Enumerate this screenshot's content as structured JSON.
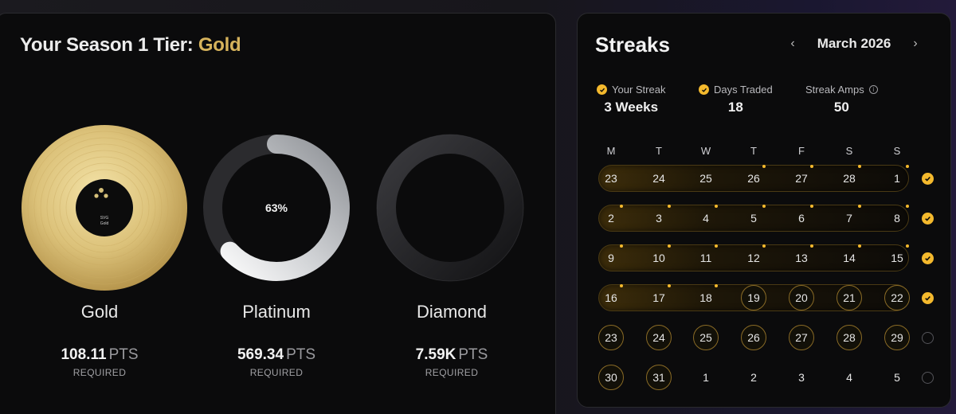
{
  "tier": {
    "title_prefix": "Your Season 1 Tier: ",
    "title_tier": "Gold",
    "tiers": [
      {
        "name": "Gold",
        "pts_value": "108.11",
        "pts_unit": "PTS",
        "required_label": "REQUIRED",
        "icon": "gold-record-icon"
      },
      {
        "name": "Platinum",
        "pts_value": "569.34",
        "pts_unit": "PTS",
        "required_label": "REQUIRED",
        "icon": "platinum-progress-ring",
        "progress_label": "63%",
        "progress": 0.63
      },
      {
        "name": "Diamond",
        "pts_value": "7.59K",
        "pts_unit": "PTS",
        "required_label": "REQUIRED",
        "icon": "diamond-ring-icon"
      }
    ],
    "record_label": "SVG\nGold"
  },
  "streaks": {
    "title": "Streaks",
    "month": "March 2026",
    "prev_icon": "chevron-left-icon",
    "next_icon": "chevron-right-icon",
    "stats": [
      {
        "label": "Your Streak",
        "value": "3 Weeks",
        "icon": "check-icon"
      },
      {
        "label": "Days Traded",
        "value": "18",
        "icon": "check-icon"
      },
      {
        "label": "Streak Amps",
        "value": "50",
        "icon": "info-icon"
      }
    ],
    "weekdays": [
      "M",
      "T",
      "W",
      "T",
      "F",
      "S",
      "S"
    ],
    "weeks": [
      {
        "days": [
          "23",
          "24",
          "25",
          "26",
          "27",
          "28",
          "1"
        ],
        "traded": [
          false,
          false,
          false,
          true,
          true,
          true,
          true
        ],
        "ringed": [
          false,
          false,
          false,
          false,
          false,
          false,
          false
        ],
        "complete": true,
        "bar": true
      },
      {
        "days": [
          "2",
          "3",
          "4",
          "5",
          "6",
          "7",
          "8"
        ],
        "traded": [
          true,
          true,
          true,
          true,
          true,
          true,
          true
        ],
        "ringed": [
          false,
          false,
          false,
          false,
          false,
          false,
          false
        ],
        "complete": true,
        "bar": true
      },
      {
        "days": [
          "9",
          "10",
          "11",
          "12",
          "13",
          "14",
          "15"
        ],
        "traded": [
          true,
          true,
          true,
          true,
          true,
          true,
          true
        ],
        "ringed": [
          false,
          false,
          false,
          false,
          false,
          false,
          false
        ],
        "complete": true,
        "bar": true
      },
      {
        "days": [
          "16",
          "17",
          "18",
          "19",
          "20",
          "21",
          "22"
        ],
        "traded": [
          true,
          true,
          true,
          false,
          false,
          false,
          false
        ],
        "ringed": [
          false,
          false,
          false,
          true,
          true,
          true,
          true
        ],
        "complete": true,
        "bar": true
      },
      {
        "days": [
          "23",
          "24",
          "25",
          "26",
          "27",
          "28",
          "29"
        ],
        "traded": [
          false,
          false,
          false,
          false,
          false,
          false,
          false
        ],
        "ringed": [
          true,
          true,
          true,
          true,
          true,
          true,
          true
        ],
        "complete": false,
        "bar": false
      },
      {
        "days": [
          "30",
          "31",
          "1",
          "2",
          "3",
          "4",
          "5"
        ],
        "traded": [
          false,
          false,
          false,
          false,
          false,
          false,
          false
        ],
        "ringed": [
          true,
          true,
          false,
          false,
          false,
          false,
          false
        ],
        "complete": false,
        "bar": false
      }
    ],
    "colors": {
      "accent": "#f4b92d",
      "gold": "#d6b35c"
    }
  }
}
